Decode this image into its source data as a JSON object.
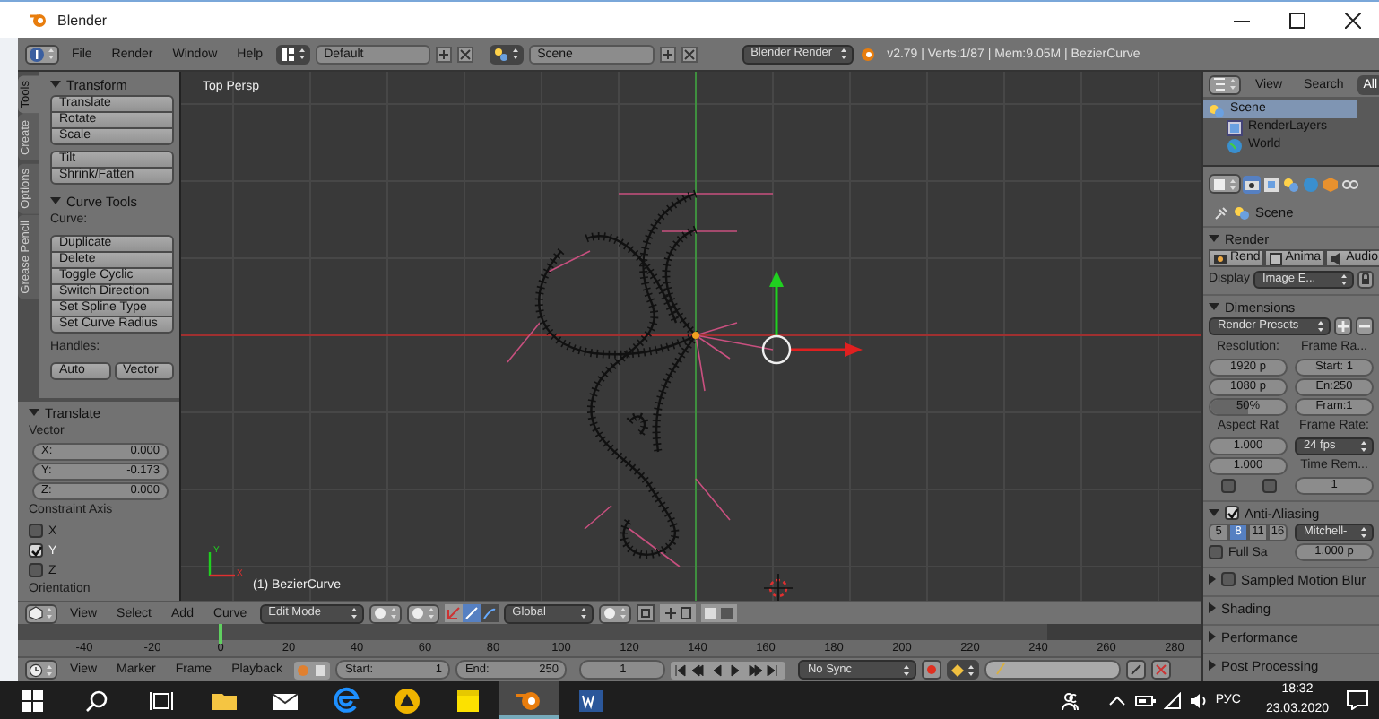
{
  "window": {
    "title": "Blender"
  },
  "info_header": {
    "menus": [
      "File",
      "Render",
      "Window",
      "Help"
    ],
    "layout": "Default",
    "scene": "Scene",
    "engine": "Blender Render",
    "stats": "v2.79 | Verts:1/87 | Mem:9.05M | BezierCurve"
  },
  "tool_shelf": {
    "tabs": [
      {
        "label": "Tools",
        "selected": true
      },
      {
        "label": "Create",
        "selected": false
      },
      {
        "label": "Options",
        "selected": false
      },
      {
        "label": "Grease Pencil",
        "selected": false
      }
    ],
    "panels": [
      {
        "title": "Transform",
        "expanded": true,
        "items": [
          {
            "kind": "column",
            "labels": [
              "Translate",
              "Rotate",
              "Scale"
            ]
          },
          {
            "kind": "column",
            "labels": [
              "Tilt",
              "Shrink/Fatten"
            ]
          }
        ]
      },
      {
        "title": "Curve Tools",
        "expanded": true,
        "items": [
          {
            "kind": "label",
            "text": "Curve:"
          },
          {
            "kind": "column",
            "labels": [
              "Duplicate",
              "Delete",
              "Toggle Cyclic",
              "Switch Direction",
              "Set Spline Type",
              "Set Curve Radius"
            ]
          },
          {
            "kind": "label",
            "text": "Handles:"
          },
          {
            "kind": "row",
            "labels": [
              "Auto",
              "Vector"
            ]
          }
        ]
      }
    ]
  },
  "operator_panel": {
    "title": "Translate",
    "expanded": true,
    "items": [
      {
        "kind": "label",
        "text": "Vector"
      },
      {
        "kind": "fields",
        "fields": [
          {
            "label": "X:",
            "value": "0.000"
          },
          {
            "label": "Y:",
            "value": "-0.173"
          },
          {
            "label": "Z:",
            "value": "0.000"
          }
        ]
      },
      {
        "kind": "label",
        "text": "Constraint Axis"
      },
      {
        "kind": "check",
        "label": "X",
        "checked": false
      },
      {
        "kind": "check",
        "label": "Y",
        "checked": true
      },
      {
        "kind": "check",
        "label": "Z",
        "checked": false
      },
      {
        "kind": "label",
        "text": "Orientation"
      }
    ]
  },
  "viewport": {
    "view_label": "Top Persp",
    "object_label": "(1) BezierCurve",
    "axis_labels": [
      "Y",
      "X"
    ]
  },
  "view_header": {
    "menus": [
      "View",
      "Select",
      "Add",
      "Curve"
    ],
    "mode": "Edit Mode",
    "orientation": "Global"
  },
  "timeline": {
    "ruler": [
      "-40",
      "-20",
      "0",
      "20",
      "40",
      "60",
      "80",
      "100",
      "120",
      "140",
      "160",
      "180",
      "200",
      "220",
      "240",
      "260",
      "280"
    ]
  },
  "timeline_header": {
    "menus": [
      "View",
      "Marker",
      "Frame",
      "Playback"
    ],
    "start_label": "Start:",
    "start": "1",
    "end_label": "End:",
    "end": "250",
    "current": "1",
    "sync": "No Sync"
  },
  "outliner": {
    "menus": [
      "View",
      "Search"
    ],
    "filter": "All",
    "items": [
      {
        "kind": "scene",
        "label": "Scene",
        "selected": true,
        "children": [
          {
            "kind": "render_layers",
            "label": "RenderLayers",
            "selected": false
          },
          {
            "kind": "world",
            "label": "World",
            "selected": false
          }
        ]
      }
    ]
  },
  "properties": {
    "tabs": [
      {
        "kind": "render",
        "selected": true
      },
      {
        "kind": "layers",
        "selected": false
      },
      {
        "kind": "scene",
        "selected": false
      },
      {
        "kind": "world",
        "selected": false
      },
      {
        "kind": "object",
        "selected": false
      },
      {
        "kind": "constraints",
        "selected": false
      }
    ],
    "context": "Scene",
    "panels": [
      {
        "title": "Render",
        "expanded": true,
        "items": [
          {
            "kind": "buttons",
            "buttons": [
              {
                "kind": "still",
                "label": "Rend"
              },
              {
                "kind": "animation",
                "label": "Anima"
              },
              {
                "kind": "audio",
                "label": "Audio"
              }
            ]
          },
          {
            "kind": "select",
            "label": "Display",
            "value": "Image E..."
          }
        ]
      },
      {
        "title": "Dimensions",
        "expanded": true,
        "items": [
          {
            "kind": "preset",
            "label": "Render Presets"
          },
          {
            "kind": "grid",
            "cells": [
              {
                "kind": "text",
                "text": "Resolution:"
              },
              {
                "kind": "text",
                "text": "Frame Ra..."
              },
              {
                "kind": "num",
                "text": "1920 p"
              },
              {
                "kind": "num",
                "text": "Start: 1"
              },
              {
                "kind": "num",
                "text": "1080 p"
              },
              {
                "kind": "num",
                "text": "En:250"
              },
              {
                "kind": "slider",
                "text": "50%",
                "level": 0.5
              },
              {
                "kind": "num",
                "text": "Fram:1"
              },
              {
                "kind": "text",
                "text": "Aspect Rat"
              },
              {
                "kind": "text",
                "text": "Frame Rate:"
              },
              {
                "kind": "num",
                "text": "1.000"
              },
              {
                "kind": "select",
                "text": "24 fps"
              },
              {
                "kind": "num",
                "text": "1.000"
              },
              {
                "kind": "text",
                "text": "Time Rem..."
              },
              {
                "kind": "checks",
                "items": [
                  {
                    "checked": false
                  },
                  {
                    "checked": false
                  }
                ]
              },
              {
                "kind": "num",
                "text": "1"
              }
            ]
          }
        ]
      },
      {
        "title": "Anti-Aliasing",
        "expanded": true,
        "checked": true,
        "items": [
          {
            "kind": "grid",
            "cells": [
              {
                "kind": "segments",
                "options": [
                  {
                    "label": "5",
                    "selected": false
                  },
                  {
                    "label": "8",
                    "selected": true
                  },
                  {
                    "label": "11",
                    "selected": false
                  },
                  {
                    "label": "16",
                    "selected": false
                  }
                ]
              },
              {
                "kind": "select",
                "text": "Mitchell-"
              },
              {
                "kind": "check",
                "text": "Full Sa",
                "checked": false
              },
              {
                "kind": "num",
                "text": "1.000 p"
              }
            ]
          }
        ]
      },
      {
        "title": "Sampled Motion Blur",
        "expanded": false,
        "checked": false
      },
      {
        "title": "Shading",
        "expanded": false
      },
      {
        "title": "Performance",
        "expanded": false
      },
      {
        "title": "Post Processing",
        "expanded": false
      }
    ]
  },
  "taskbar": {
    "apps": [
      {
        "kind": "folder",
        "selected": false
      },
      {
        "kind": "mail",
        "selected": false
      },
      {
        "kind": "browser",
        "selected": false
      },
      {
        "kind": "triangle",
        "selected": false
      },
      {
        "kind": "notes",
        "selected": false
      },
      {
        "kind": "blender",
        "selected": true
      },
      {
        "kind": "word",
        "selected": false
      }
    ],
    "language": "РУС",
    "time": "18:32",
    "date": "23.03.2020"
  }
}
